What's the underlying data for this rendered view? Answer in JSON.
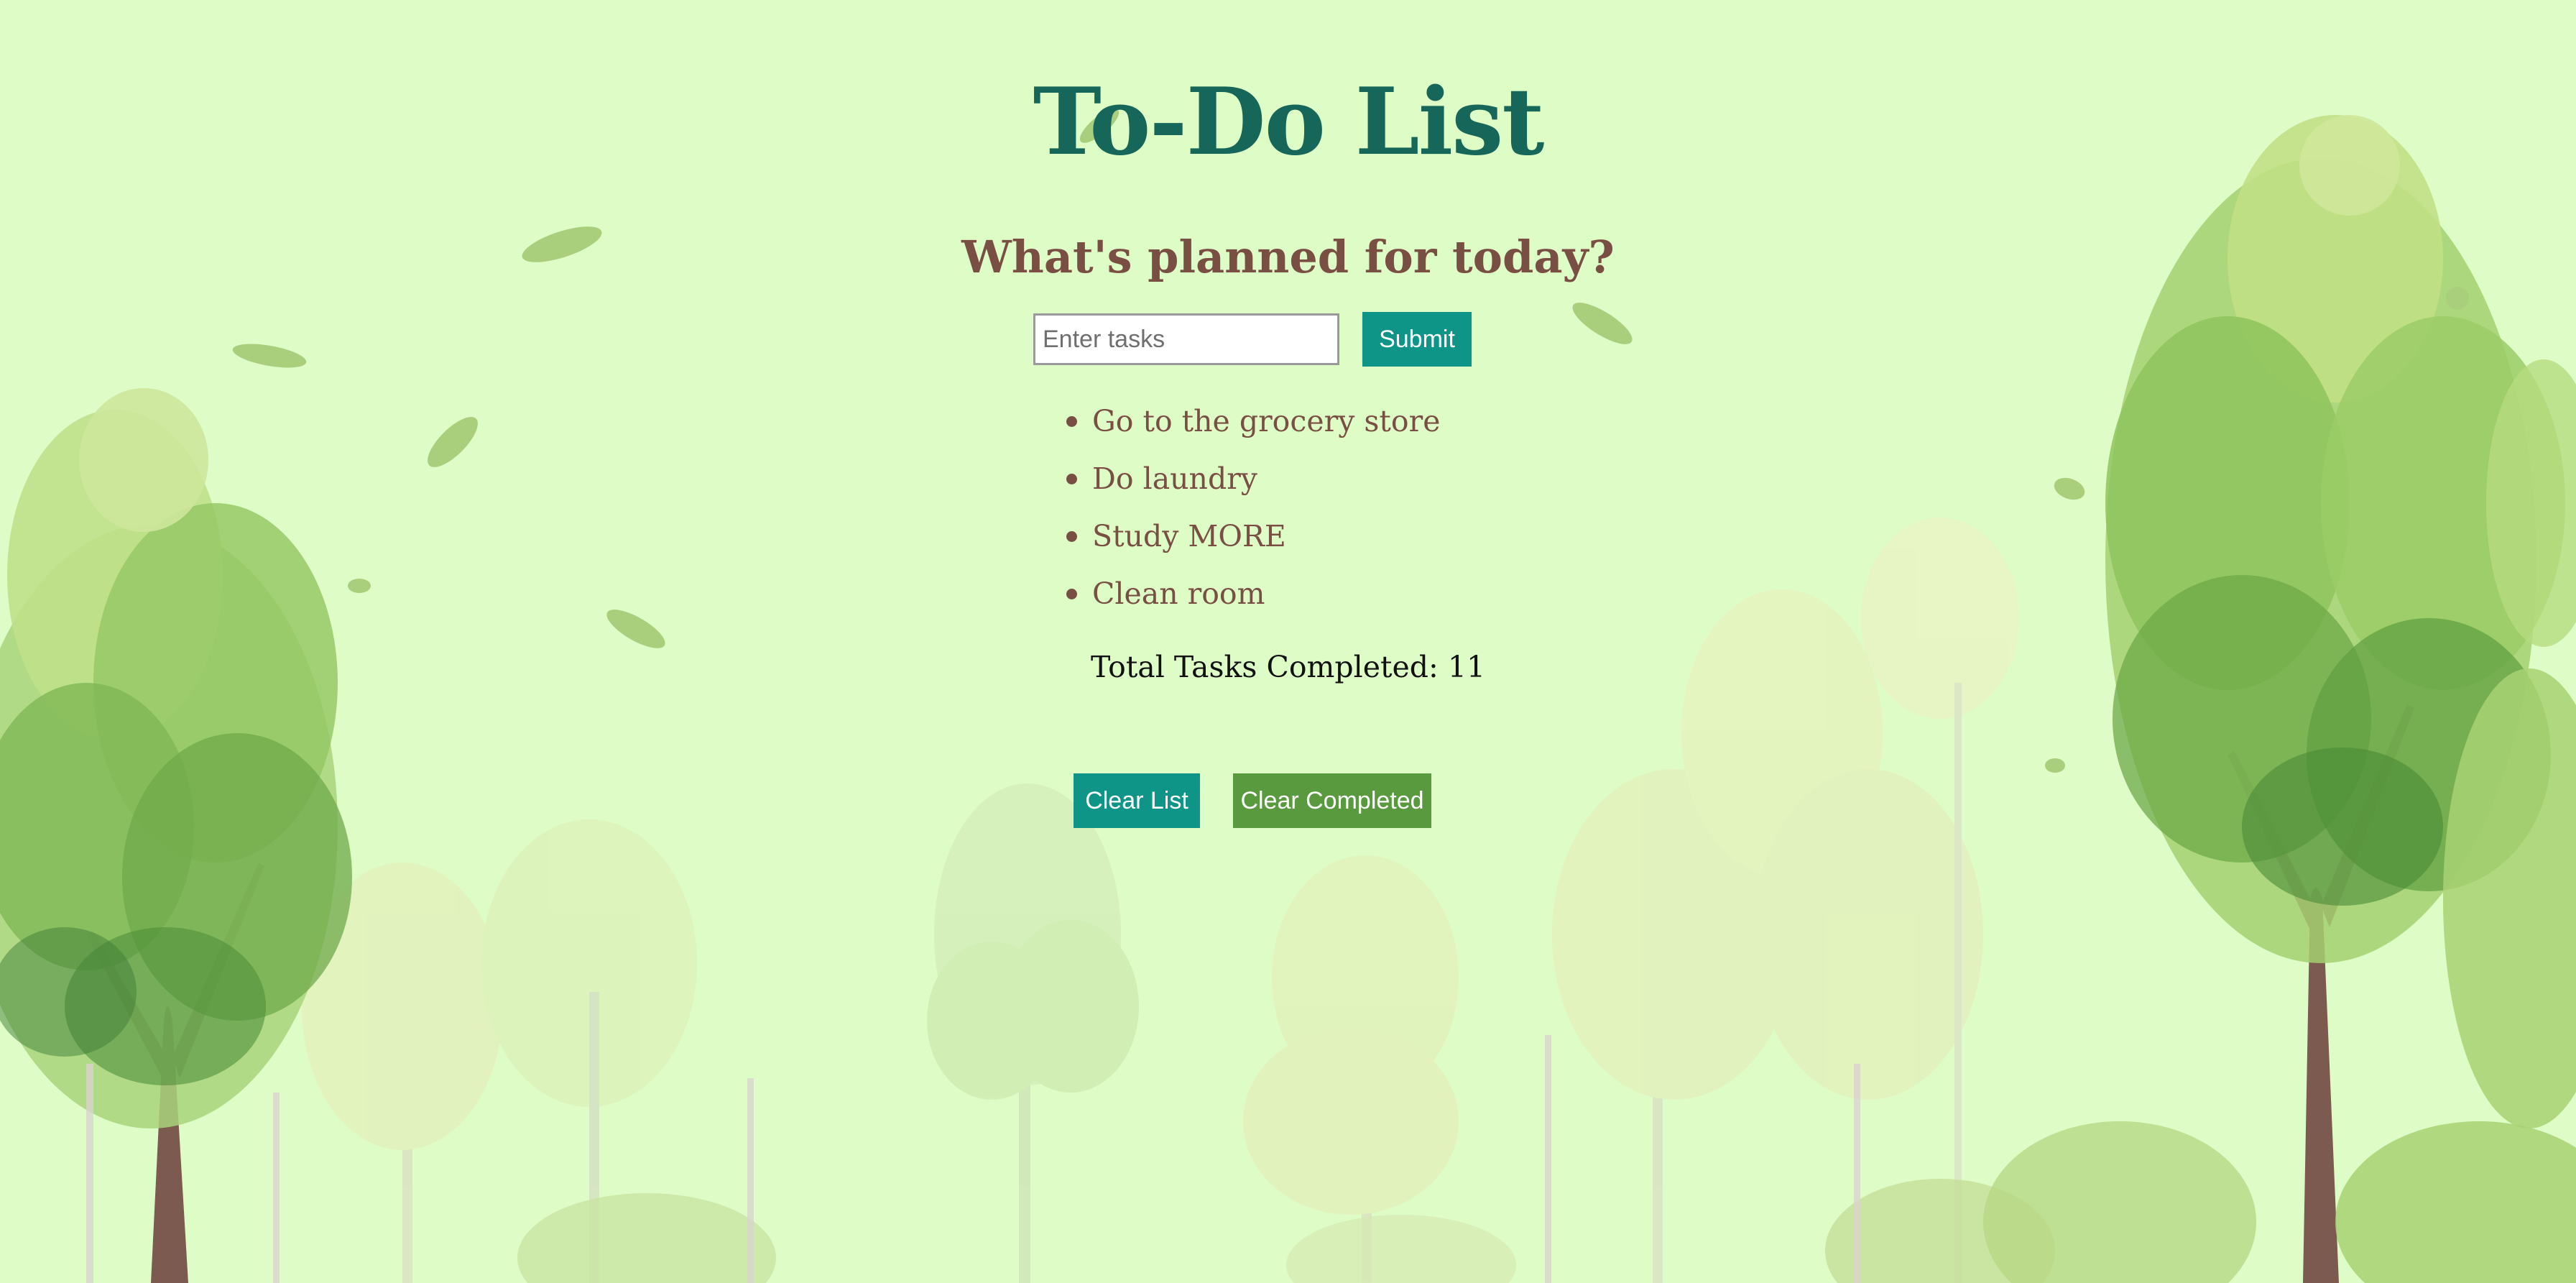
{
  "page": {
    "title": "To-Do List",
    "subtitle": "What's planned for today?"
  },
  "form": {
    "input_value": "",
    "input_placeholder": "Enter tasks",
    "submit_label": "Submit"
  },
  "tasks": [
    {
      "text": "Go to the grocery store"
    },
    {
      "text": "Do laundry"
    },
    {
      "text": "Study MORE"
    },
    {
      "text": "Clean room"
    }
  ],
  "stats": {
    "total_label": "Total Tasks Completed:",
    "total_value": "11"
  },
  "actions": {
    "clear_list_label": "Clear List",
    "clear_completed_label": "Clear Completed"
  },
  "colors": {
    "background": "#ddfcc6",
    "title": "#17665a",
    "subtitle": "#7a4f43",
    "task_text": "#7a4f43",
    "teal_button": "#0e9588",
    "green_button": "#5a9a3e"
  },
  "icons": {
    "task_bullet": "bullet-dot-icon",
    "decoration": "falling-leaf-icon"
  }
}
